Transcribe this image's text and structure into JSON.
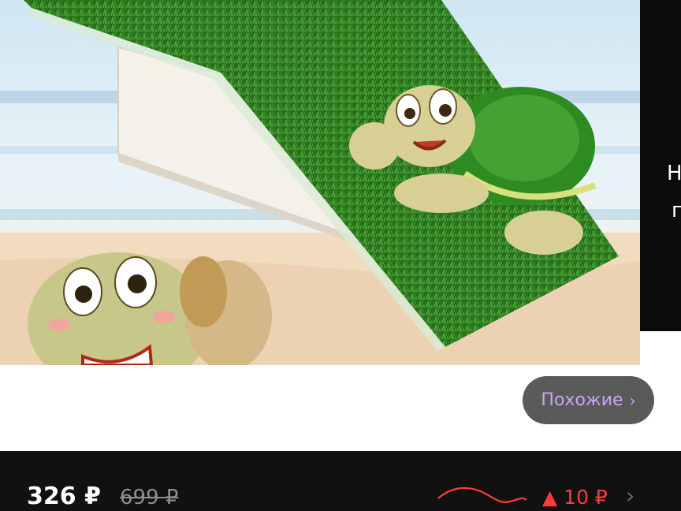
{
  "side_panel": {
    "line1": "Н",
    "line2": "г"
  },
  "similar_button": {
    "label": "Похожие",
    "chevron": "›"
  },
  "price_bar": {
    "price": "326 ₽",
    "old_price": "699 ₽",
    "change": "▲ 10 ₽",
    "chevron": "›"
  },
  "colors": {
    "accent_purple": "#c9a4f7",
    "price_up_red": "#ff3b3b"
  },
  "icons": [
    "trend-line-icon",
    "chevron-right-icon"
  ]
}
